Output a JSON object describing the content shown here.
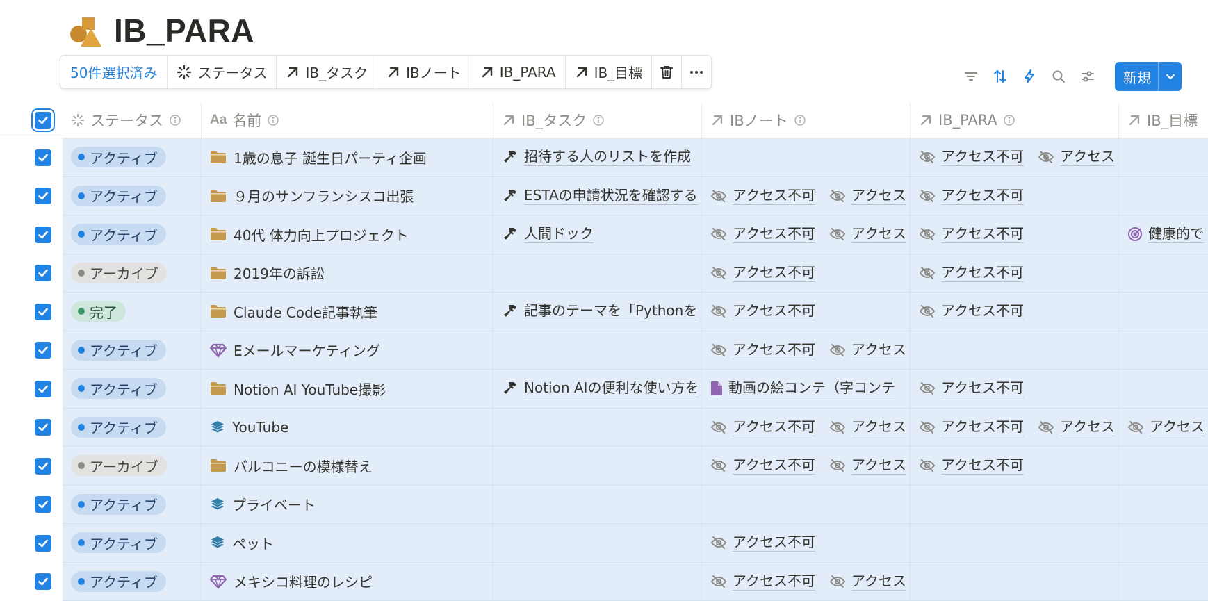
{
  "page": {
    "title": "IB_PARA"
  },
  "bulkbar": {
    "selected": "50件選択済み",
    "items": [
      {
        "label": "ステータス",
        "icon": "status-icon"
      },
      {
        "label": "IB_タスク",
        "icon": "relation-arrow-icon"
      },
      {
        "label": "IBノート",
        "icon": "relation-arrow-icon"
      },
      {
        "label": "IB_PARA",
        "icon": "relation-arrow-icon"
      },
      {
        "label": "IB_目標",
        "icon": "relation-arrow-icon"
      }
    ],
    "delete_icon": "trash-icon",
    "more_icon": "more-icon"
  },
  "toolbar": {
    "new_label": "新規",
    "icons": [
      "filter-icon",
      "sort-icon",
      "automation-icon",
      "search-icon",
      "settings-icon",
      "chevron-down-icon"
    ]
  },
  "columns": {
    "status": "ステータス",
    "name": "名前",
    "task": "IB_タスク",
    "note": "IBノート",
    "para": "IB_PARA",
    "goal": "IB_目標"
  },
  "rows": [
    {
      "status": "アクティブ",
      "name": "1歳の息子 誕生日パーティ企画",
      "task": "招待する人のリストを作成",
      "note1": "",
      "note2": "",
      "para1": "アクセス不可",
      "para2": "アクセス",
      "goal": ""
    },
    {
      "status": "アクティブ",
      "name": "９月のサンフランシスコ出張",
      "task": "ESTAの申請状況を確認する",
      "note1": "アクセス不可",
      "note2": "アクセス",
      "para1": "アクセス不可",
      "para2": "",
      "goal": ""
    },
    {
      "status": "アクティブ",
      "name": "40代 体力向上プロジェクト",
      "task": "人間ドック",
      "note1": "アクセス不可",
      "note2": "アクセス",
      "para1": "アクセス不可",
      "para2": "",
      "goal": "健康的で"
    },
    {
      "status": "アーカイブ",
      "name": "2019年の訴訟",
      "task": "",
      "note1": "アクセス不可",
      "note2": "",
      "para1": "アクセス不可",
      "para2": "",
      "goal": ""
    },
    {
      "status": "完了",
      "name": "Claude Code記事執筆",
      "task": "記事のテーマを「Pythonを",
      "note1": "アクセス不可",
      "note2": "",
      "para1": "アクセス不可",
      "para2": "",
      "goal": ""
    },
    {
      "status": "アクティブ",
      "name": "Eメールマーケティング",
      "task": "",
      "note1": "アクセス不可",
      "note2": "アクセス",
      "para1": "",
      "para2": "",
      "goal": ""
    },
    {
      "status": "アクティブ",
      "name": "Notion AI YouTube撮影",
      "task": "Notion AIの便利な使い方を",
      "note1": "動画の絵コンテ（字コンテ",
      "note2": "",
      "para1": "アクセス不可",
      "para2": "",
      "goal": ""
    },
    {
      "status": "アクティブ",
      "name": "YouTube",
      "task": "",
      "note1": "アクセス不可",
      "note2": "アクセス",
      "para1": "アクセス不可",
      "para2": "アクセス",
      "goal": "アクセス"
    },
    {
      "status": "アーカイブ",
      "name": "バルコニーの模様替え",
      "task": "",
      "note1": "アクセス不可",
      "note2": "アクセス",
      "para1": "アクセス不可",
      "para2": "",
      "goal": ""
    },
    {
      "status": "アクティブ",
      "name": "プライベート",
      "task": "",
      "note1": "",
      "note2": "",
      "para1": "",
      "para2": "",
      "goal": ""
    },
    {
      "status": "アクティブ",
      "name": "ペット",
      "task": "",
      "note1": "アクセス不可",
      "note2": "",
      "para1": "",
      "para2": "",
      "goal": ""
    },
    {
      "status": "アクティブ",
      "name": "メキシコ料理のレシピ",
      "task": "",
      "note1": "アクセス不可",
      "note2": "アクセス",
      "para1": "",
      "para2": "",
      "goal": ""
    }
  ],
  "colors": {
    "accent": "#2383e2",
    "selection_bg": "#e2edf9",
    "folder": "#c39a4e",
    "gem": "#9065b0",
    "stack": "#337ea9"
  }
}
